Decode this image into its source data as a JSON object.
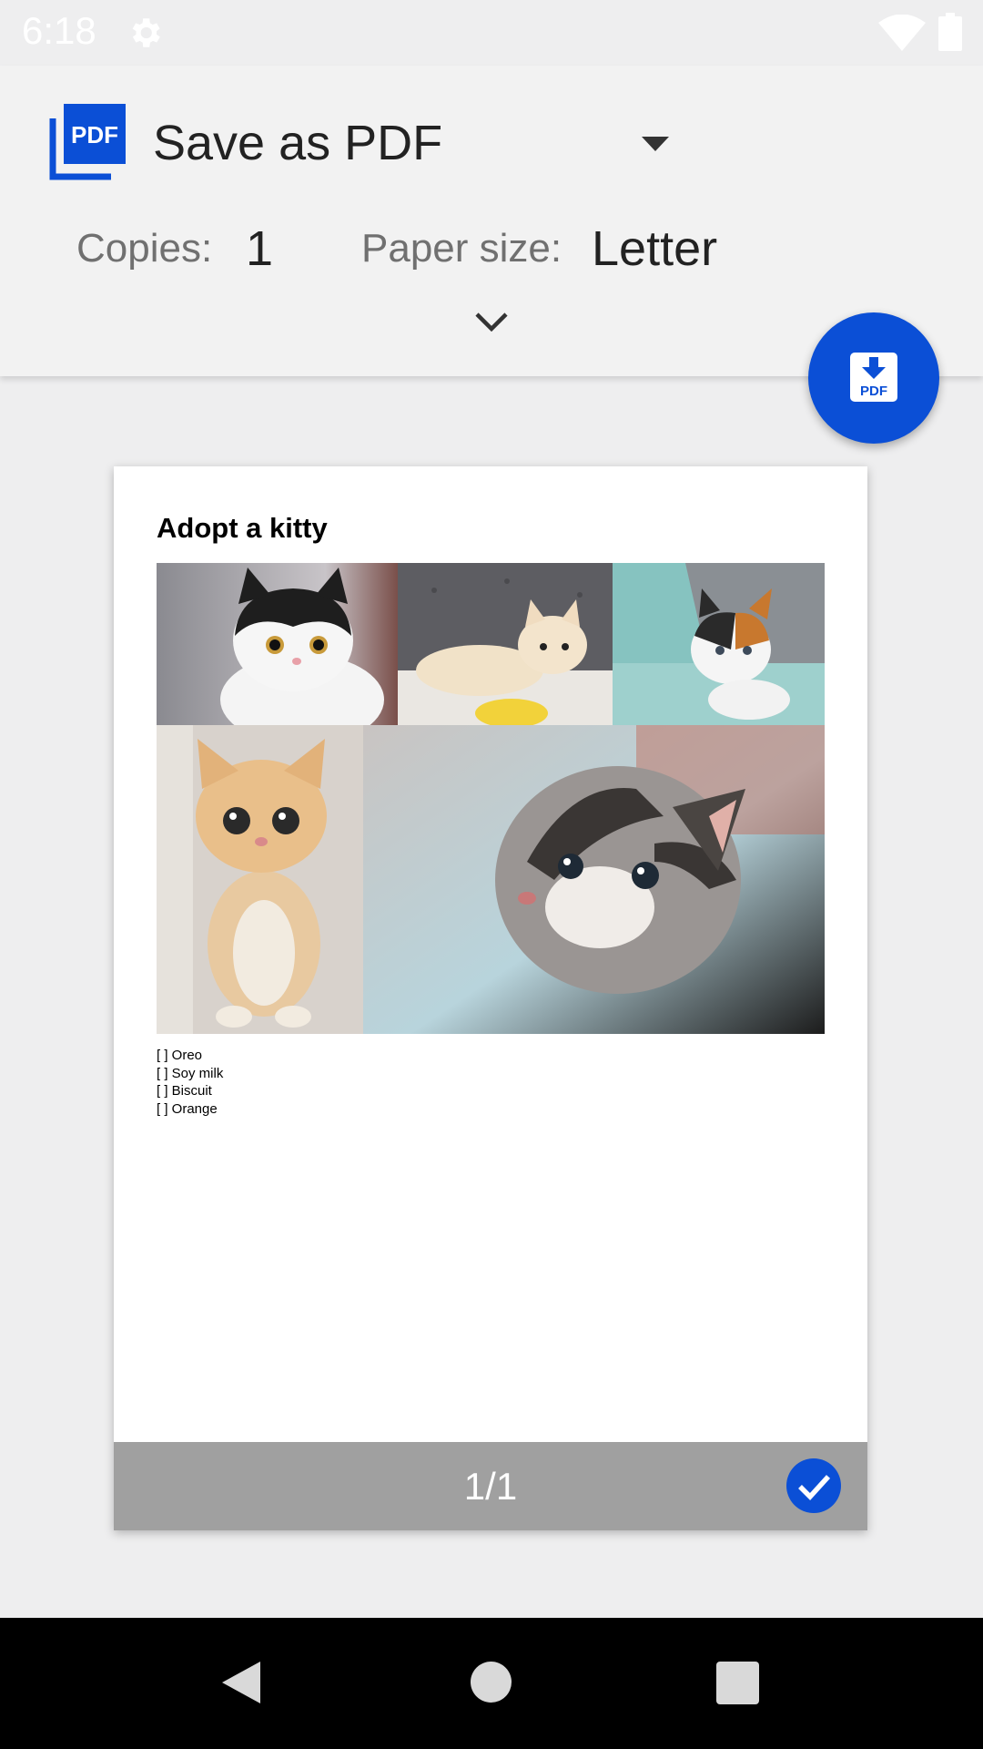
{
  "status_bar": {
    "time": "6:18",
    "icons": [
      "gear-icon",
      "wifi-icon",
      "battery-icon"
    ]
  },
  "printer": {
    "name": "Save as PDF",
    "icon": "pdf-icon"
  },
  "options": {
    "copies_label": "Copies:",
    "copies_value": "1",
    "paper_label": "Paper size:",
    "paper_value": "Letter"
  },
  "fab": {
    "icon": "pdf-download-icon"
  },
  "preview": {
    "title": "Adopt a kitty",
    "photos": [
      "black-white-kitten",
      "cream-kitten",
      "calico-kitten",
      "orange-kitten",
      "tabby-kitten"
    ],
    "checklist": [
      "[ ] Oreo",
      "[ ] Soy milk",
      "[ ] Biscuit",
      "[ ] Orange"
    ],
    "page_indicator": "1/1"
  },
  "colors": {
    "accent": "#0b4fd6",
    "header_bg": "#f2f2f2",
    "background": "#eeeeef",
    "footer_bg": "#a0a0a0"
  }
}
